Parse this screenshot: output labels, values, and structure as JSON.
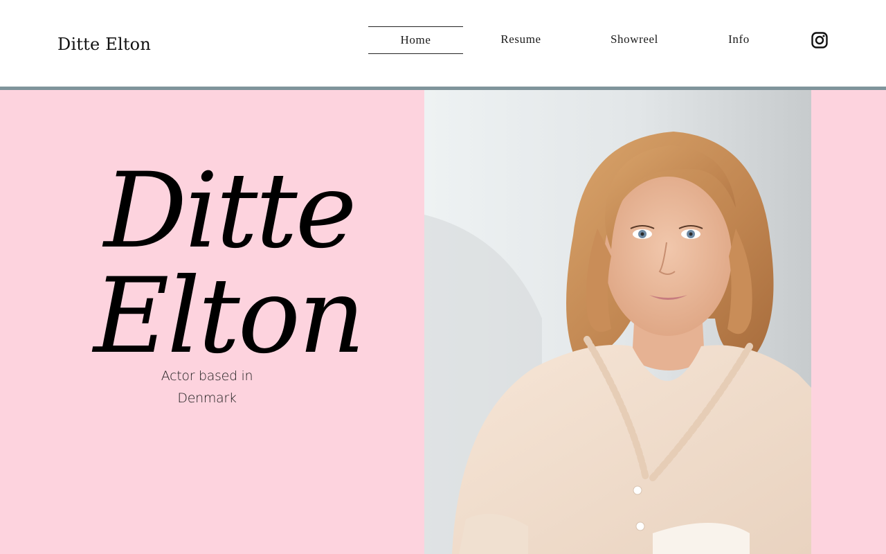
{
  "header": {
    "site_title": "Ditte Elton",
    "nav": [
      {
        "label": "Home",
        "active": true
      },
      {
        "label": "Resume",
        "active": false
      },
      {
        "label": "Showreel",
        "active": false
      },
      {
        "label": "Info",
        "active": false
      }
    ],
    "social_icon": "instagram-icon"
  },
  "hero": {
    "first_name": "Ditte",
    "last_name": "Elton",
    "tagline_line1": "Actor based in",
    "tagline_line2": "Denmark",
    "photo": "portrait-photo"
  },
  "colors": {
    "hero_background": "#fdd3de",
    "divider": "#7f949b",
    "text": "#000000",
    "header_background": "#ffffff"
  }
}
